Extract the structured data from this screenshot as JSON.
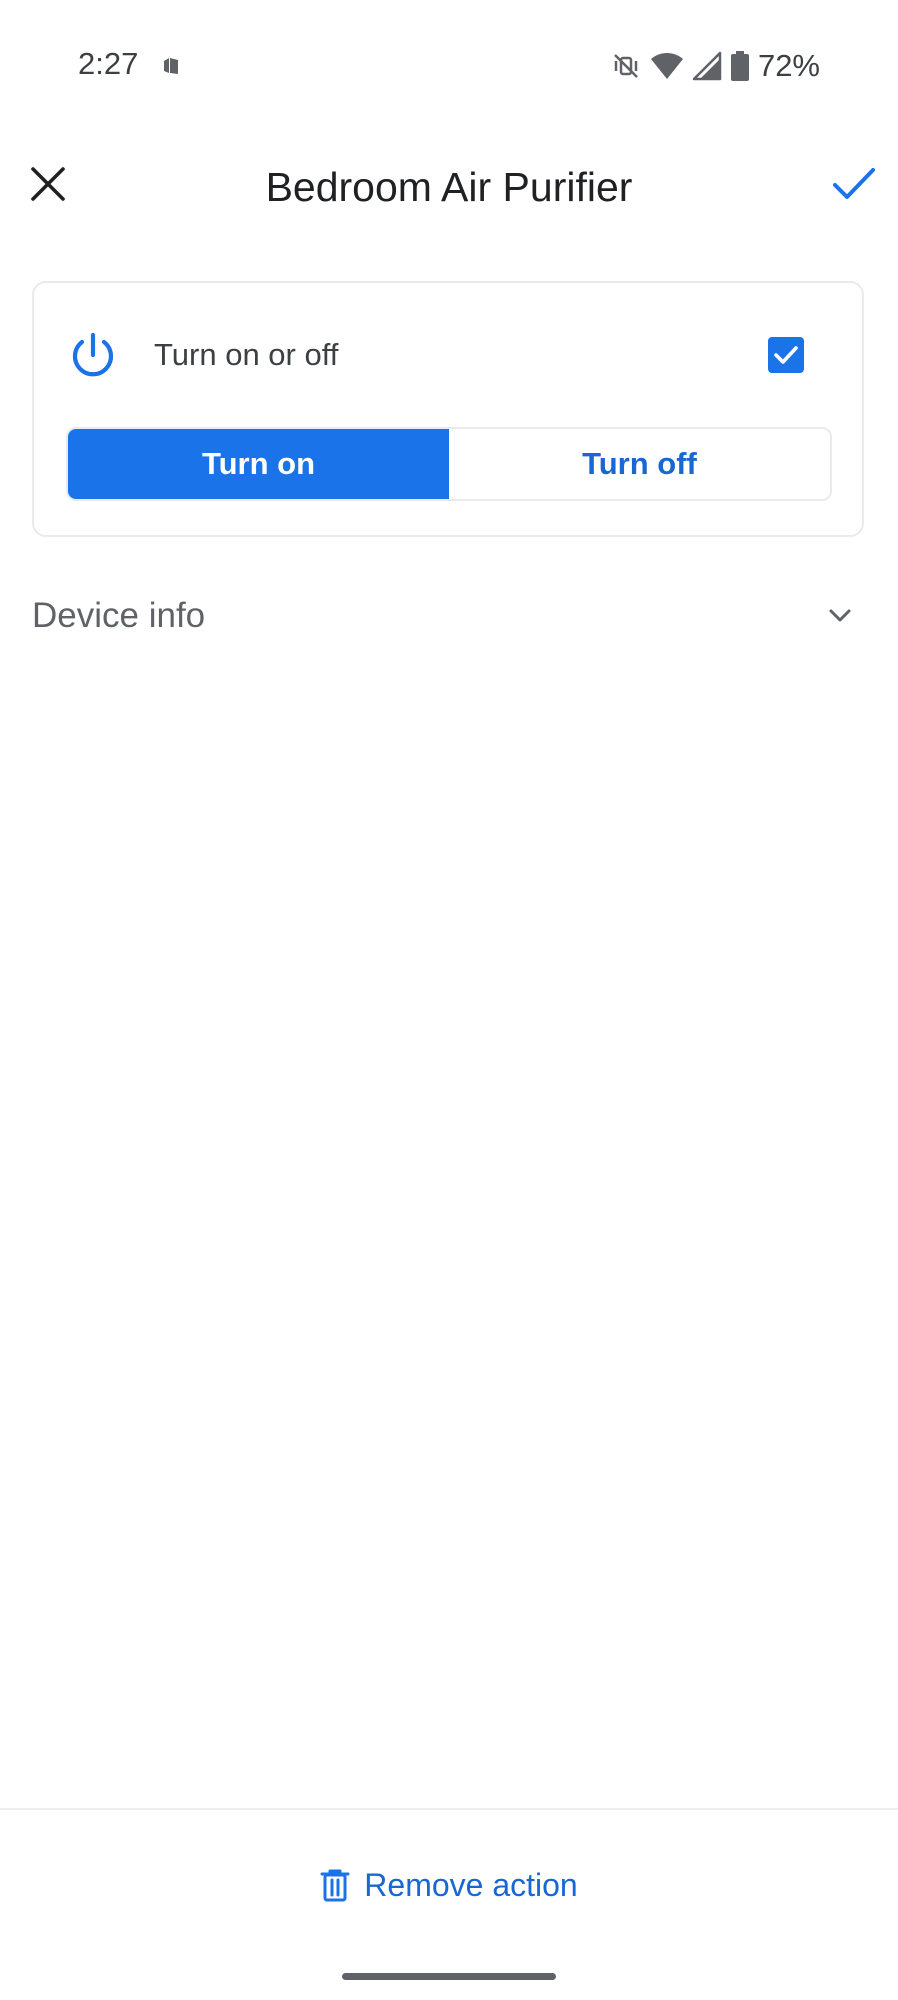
{
  "status_bar": {
    "time": "2:27",
    "battery": "72%",
    "icons": [
      "app-notification-icon",
      "vibrate-off-icon",
      "wifi-icon",
      "cell-signal-icon",
      "battery-icon"
    ]
  },
  "app_bar": {
    "title": "Bedroom Air Purifier",
    "close_icon": "close-icon",
    "confirm_icon": "check-icon"
  },
  "card": {
    "trait_label": "Turn on or off",
    "trait_icon": "power-icon",
    "trait_checked": true,
    "turn_on_label": "Turn on",
    "turn_off_label": "Turn off",
    "selected": "Turn on"
  },
  "device_info": {
    "label": "Device info",
    "expanded": false
  },
  "bottom": {
    "remove_label": "Remove action",
    "remove_icon": "trash-icon"
  },
  "colors": {
    "accent": "#1a73e8",
    "accent_text": "#1967d2",
    "text_primary": "#202124",
    "text_secondary": "#5f6368",
    "border": "#e8eaed"
  }
}
